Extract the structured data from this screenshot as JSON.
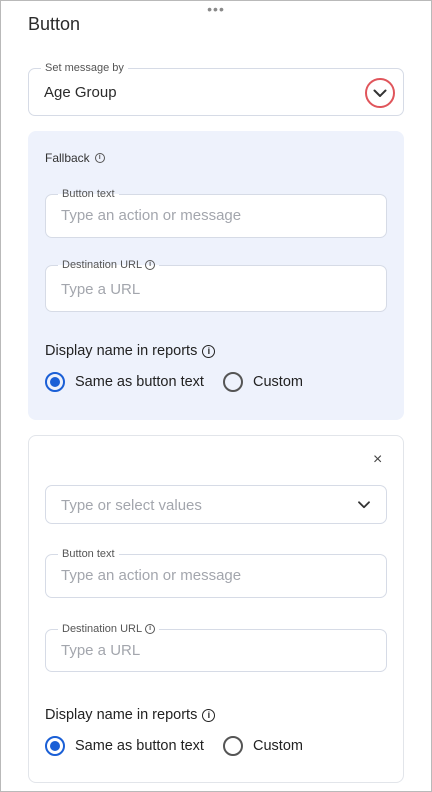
{
  "header": {
    "title": "Button",
    "drag_handle": "•••"
  },
  "set_message": {
    "legend": "Set message by",
    "value": "Age Group"
  },
  "fallback": {
    "label": "Fallback",
    "button_text": {
      "legend": "Button text",
      "placeholder": "Type an action or message"
    },
    "destination_url": {
      "legend": "Destination URL",
      "placeholder": "Type a URL"
    },
    "display_name": {
      "label": "Display name in reports",
      "options": [
        {
          "label": "Same as button text",
          "checked": true
        },
        {
          "label": "Custom",
          "checked": false
        }
      ]
    }
  },
  "rule": {
    "close": "×",
    "values_select": {
      "placeholder": "Type or select values"
    },
    "button_text": {
      "legend": "Button text",
      "placeholder": "Type an action or message"
    },
    "destination_url": {
      "legend": "Destination URL",
      "placeholder": "Type a URL"
    },
    "display_name": {
      "label": "Display name in reports",
      "options": [
        {
          "label": "Same as button text",
          "checked": true
        },
        {
          "label": "Custom",
          "checked": false
        }
      ]
    }
  },
  "icons": {
    "info": "i",
    "accent": "#1a5fd6",
    "highlight": "#e0555b"
  }
}
